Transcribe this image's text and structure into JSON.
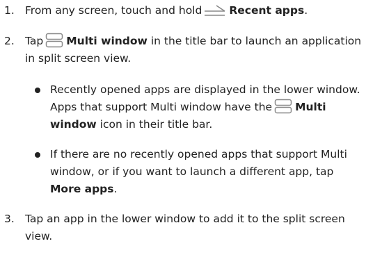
{
  "steps": [
    {
      "number": "1.",
      "text_before": "From any screen, touch and hold",
      "icon": "recent-apps-icon",
      "bold": "Recent apps",
      "text_after": "."
    },
    {
      "number": "2.",
      "text_before": "Tap",
      "icon": "multi-window-icon",
      "bold": "Multi window",
      "text_after": "in the title bar to launch an application in split screen view.",
      "bullets": [
        {
          "line1": "Recently opened apps are displayed in the lower window. Apps that support Multi window have the",
          "icon": "multi-window-icon",
          "bold": "Multi window",
          "line2": "icon in their title bar."
        },
        {
          "text": "If there are no recently opened apps that support Multi window, or if you want to launch a different app, tap",
          "bold": "More apps",
          "text_after": "."
        }
      ]
    },
    {
      "number": "3.",
      "text": "Tap an app in the lower window to add it to the split screen view."
    }
  ],
  "colors": {
    "text": "#222222",
    "icon": "#888888"
  }
}
